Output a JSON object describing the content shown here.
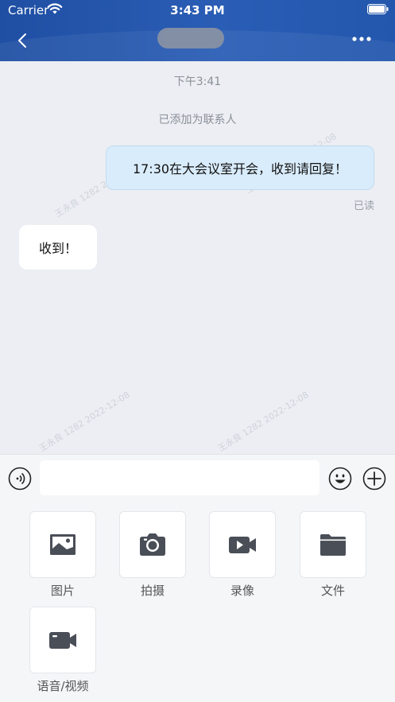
{
  "status_bar": {
    "carrier": "Carrier",
    "time": "3:43 PM"
  },
  "chat": {
    "timestamp": "下午3:41",
    "system_message": "已添加为联系人",
    "messages": [
      {
        "side": "right",
        "text": "17:30在大会议室开会，收到请回复！",
        "status": "已读"
      },
      {
        "side": "left",
        "text": "收到！"
      }
    ],
    "watermark": "王永良 1282 2022-12-08"
  },
  "input": {
    "value": "",
    "placeholder": ""
  },
  "actions": [
    {
      "label": "图片",
      "icon": "image-icon"
    },
    {
      "label": "拍摄",
      "icon": "camera-icon"
    },
    {
      "label": "录像",
      "icon": "video-camera-icon"
    },
    {
      "label": "文件",
      "icon": "folder-icon"
    },
    {
      "label": "语音/视频",
      "icon": "video-call-icon"
    }
  ],
  "colors": {
    "header": "#2357ad",
    "bubble_out": "#d9ecfb",
    "icon": "#4a4e57"
  }
}
